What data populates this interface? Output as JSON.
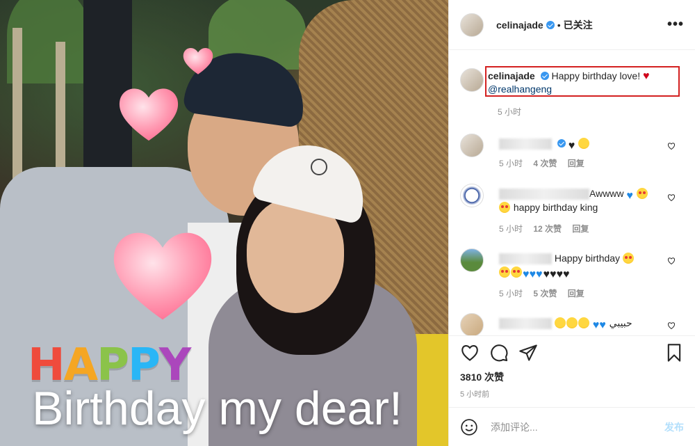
{
  "photo": {
    "happy_text": [
      "H",
      "A",
      "P",
      "P",
      "Y"
    ],
    "happy_colors": [
      "#ef4b3c",
      "#f5a623",
      "#8bc34a",
      "#29b6f6",
      "#ab47bc"
    ],
    "bday_text": "Birthday my dear!"
  },
  "header": {
    "username": "celinajade",
    "separator": "•",
    "follow_status": "已关注",
    "more": "•••"
  },
  "caption": {
    "username": "celinajade",
    "text": "Happy birthday love!",
    "heart": "♥",
    "mention": "@realhangeng",
    "time": "5 小时"
  },
  "comments": [
    {
      "time": "5 小时",
      "likes": "4 次赞",
      "reply": "回复",
      "text_suffix": ""
    },
    {
      "time": "5 小时",
      "likes": "12 次赞",
      "reply": "回复",
      "text_prefix": "Awwww",
      "text_line2": "happy birthday king"
    },
    {
      "time": "5 小时",
      "likes": "5 次赞",
      "reply": "回复",
      "text_prefix": "Happy birthday"
    },
    {
      "text_suffix": "حبيبي"
    }
  ],
  "actions": {
    "likes_count": "3810 次赞",
    "post_time": "5 小时前"
  },
  "add_comment": {
    "placeholder": "添加评论...",
    "send": "发布"
  }
}
